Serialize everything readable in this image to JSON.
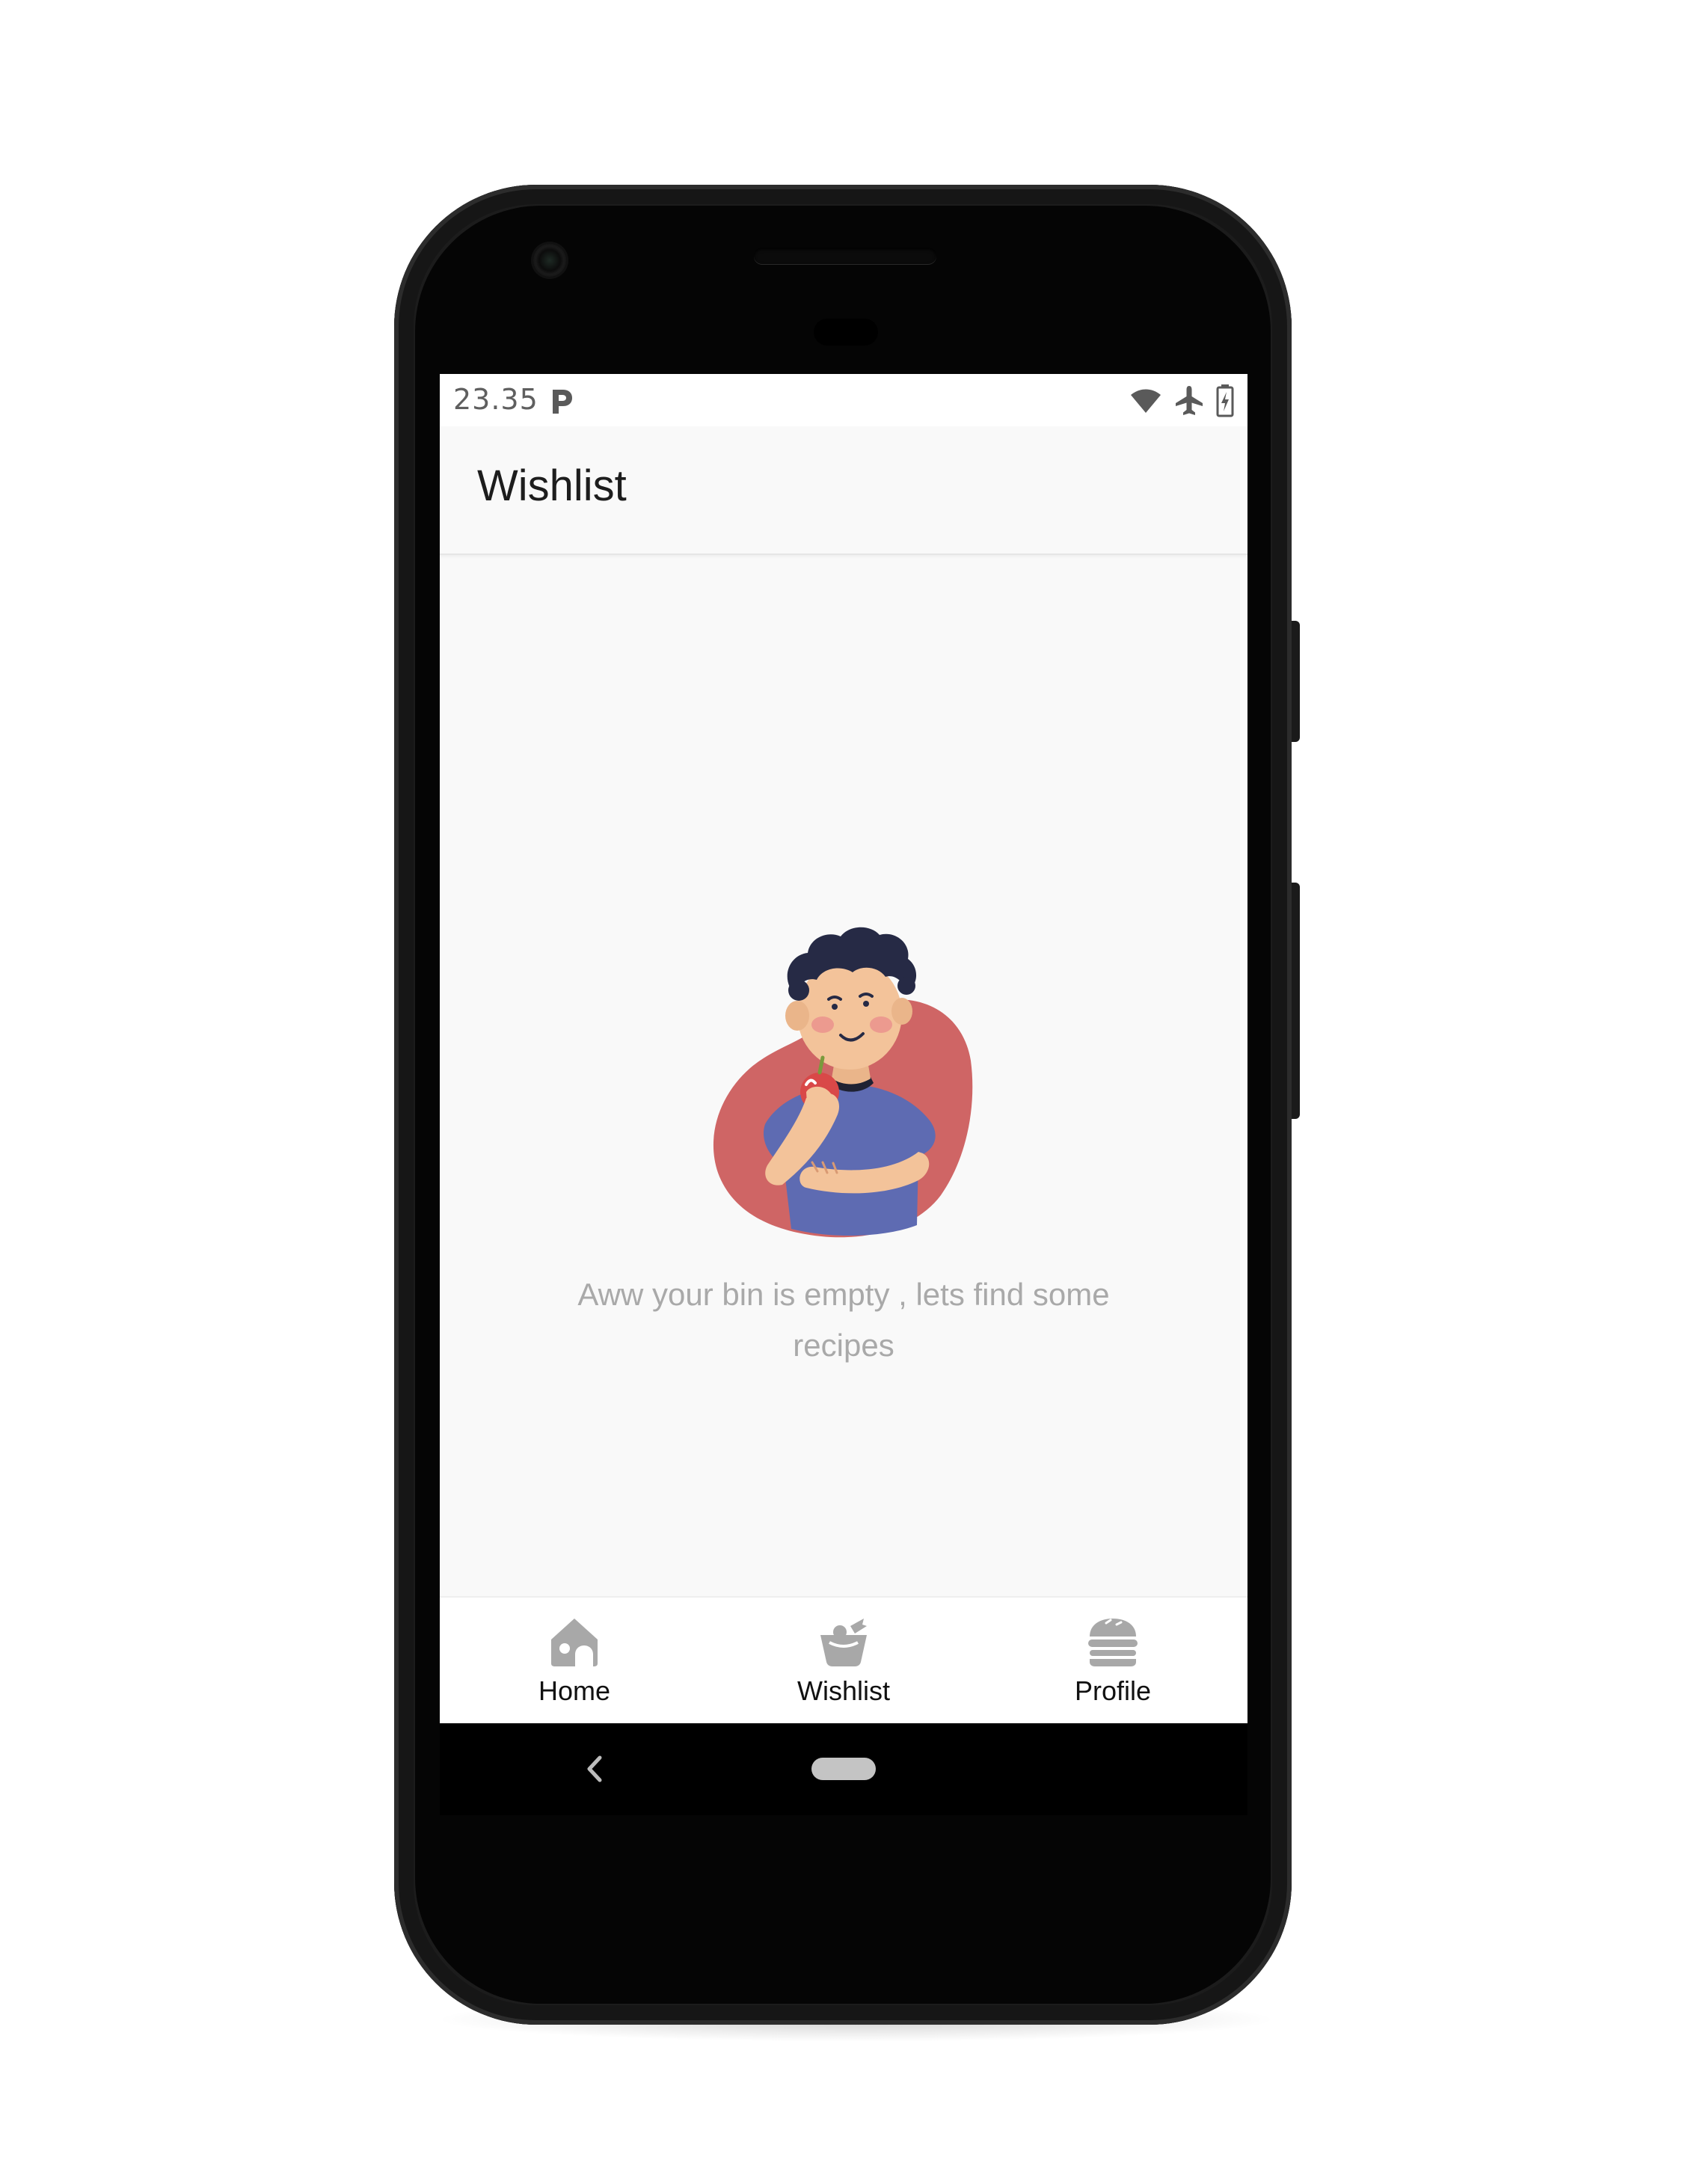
{
  "status_bar": {
    "time": "23.35",
    "icons": [
      "parking-notification-icon",
      "wifi-icon",
      "airplane-icon",
      "battery-charging-icon"
    ]
  },
  "app_bar": {
    "title": "Wishlist"
  },
  "empty_state": {
    "illustration": "boy-eating-apple-illustration",
    "message": "Aww your bin is empty , lets find some recipes"
  },
  "bottom_nav": {
    "items": [
      {
        "label": "Home",
        "icon": "home-icon"
      },
      {
        "label": "Wishlist",
        "icon": "basket-icon"
      },
      {
        "label": "Profile",
        "icon": "burger-icon"
      }
    ]
  },
  "colors": {
    "background": "#f9f9f9",
    "nav_icon": "#a8a8a8",
    "empty_text": "#a9a9a9",
    "blob": "#cf6565",
    "shirt": "#5e6bb2",
    "hair": "#262a45",
    "skin": "#f3c39a"
  }
}
